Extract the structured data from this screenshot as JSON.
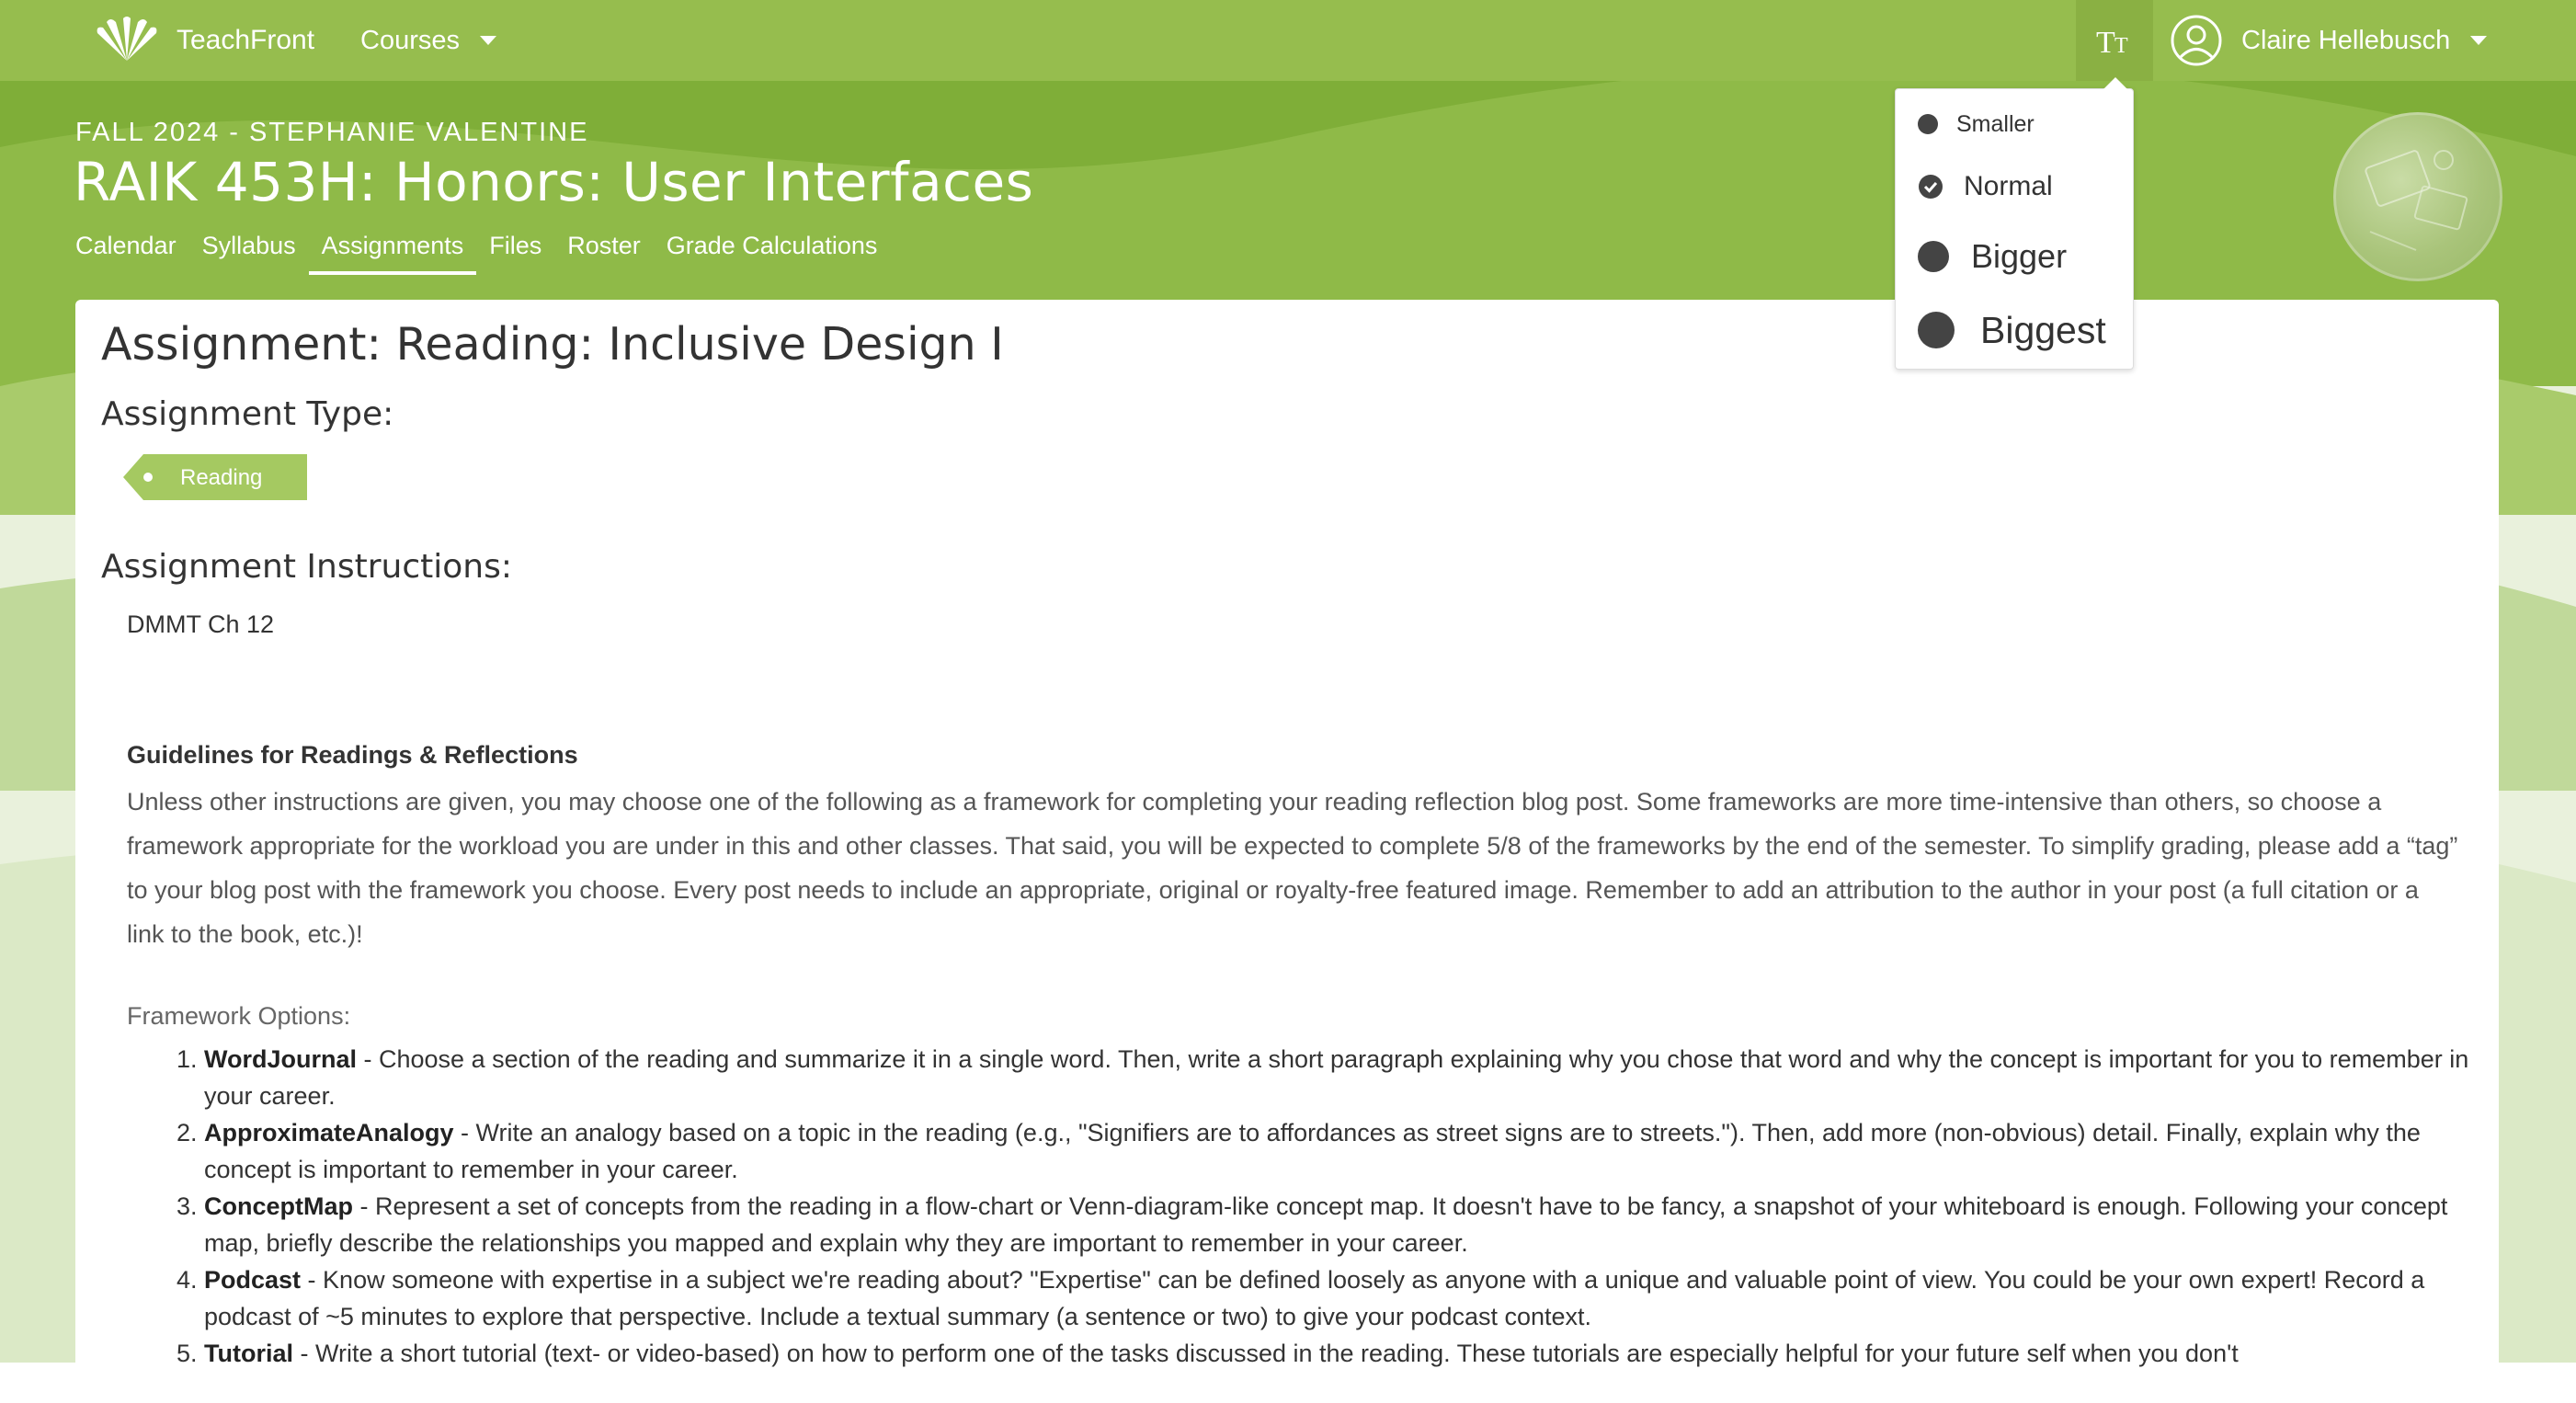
{
  "app": {
    "brand": "TeachFront",
    "courses_label": "Courses",
    "user_name": "Claire Hellebusch",
    "text_size_icon_label": "TT"
  },
  "colors": {
    "nav_green": "#96bd4e",
    "accent_green": "#8ab043",
    "tag_green": "#a5c961"
  },
  "icons": {
    "logo": "shell-logo-icon",
    "courses_caret": "chevron-down-icon",
    "text_size": "text-size-icon",
    "user_avatar": "user-circle-icon",
    "user_caret": "chevron-down-icon",
    "selected": "check-circle-icon"
  },
  "course": {
    "term": "FALL 2024 - STEPHANIE VALENTINE",
    "title": "RAIK 453H: Honors: User Interfaces",
    "tabs": [
      {
        "label": "Calendar",
        "active": false
      },
      {
        "label": "Syllabus",
        "active": false
      },
      {
        "label": "Assignments",
        "active": true
      },
      {
        "label": "Files",
        "active": false
      },
      {
        "label": "Roster",
        "active": false
      },
      {
        "label": "Grade Calculations",
        "active": false
      }
    ]
  },
  "text_size_menu": {
    "items": [
      {
        "label": "Smaller",
        "selected": false
      },
      {
        "label": "Normal",
        "selected": true
      },
      {
        "label": "Bigger",
        "selected": false
      },
      {
        "label": "Biggest",
        "selected": false
      }
    ]
  },
  "assignment": {
    "heading": "Assignment: Reading: Inclusive Design I",
    "type_heading": "Assignment Type:",
    "type_tag": "Reading",
    "instructions_heading": "Assignment Instructions:",
    "instructions_first_line": "DMMT Ch 12",
    "guidelines_title": "Guidelines for Readings & Reflections",
    "guidelines_body": "Unless other instructions are given, you may choose one of the following as a framework for completing your reading reflection blog post. Some frameworks are more time-intensive than others, so choose a framework appropriate for the workload you are under in this and other classes. That said, you will be expected to complete 5/8 of the frameworks by the end of the semester. To simplify grading, please add a “tag” to your blog post with the framework you choose. Every post needs to include an appropriate, original or royalty-free featured image. Remember to add an attribution to the author in your post (a full citation or a link to the book, etc.)!",
    "framework_label": "Framework Options:",
    "frameworks": [
      {
        "name": "WordJournal",
        "text": " - Choose a section of the reading and summarize it in a single word. Then, write a short paragraph explaining why you chose that word and why the concept is important for you to remember in your career."
      },
      {
        "name": "ApproximateAnalogy",
        "text": " - Write an analogy based on a topic in the reading (e.g., \"Signifiers are to affordances as street signs are to streets.\"). Then, add more (non-obvious) detail. Finally, explain why the concept is important to remember in your career."
      },
      {
        "name": "ConceptMap",
        "text": " - Represent a set of concepts from the reading in a flow-chart or Venn-diagram-like concept map. It doesn't have to be fancy, a snapshot of your whiteboard is enough. Following your concept map, briefly describe the relationships you mapped and explain why they are important to remember in your career."
      },
      {
        "name": "Podcast",
        "text": " - Know someone with expertise in a subject we're reading about? \"Expertise\" can be defined loosely as anyone with a unique and valuable point of view. You could be your own expert! Record a podcast of ~5 minutes to explore that perspective. Include a textual summary (a sentence or two) to give your podcast context."
      },
      {
        "name": "Tutorial",
        "text": " - Write a short tutorial (text- or video-based) on how to perform one of the tasks discussed in the reading. These tutorials are especially helpful for your future self when you don't"
      }
    ]
  }
}
